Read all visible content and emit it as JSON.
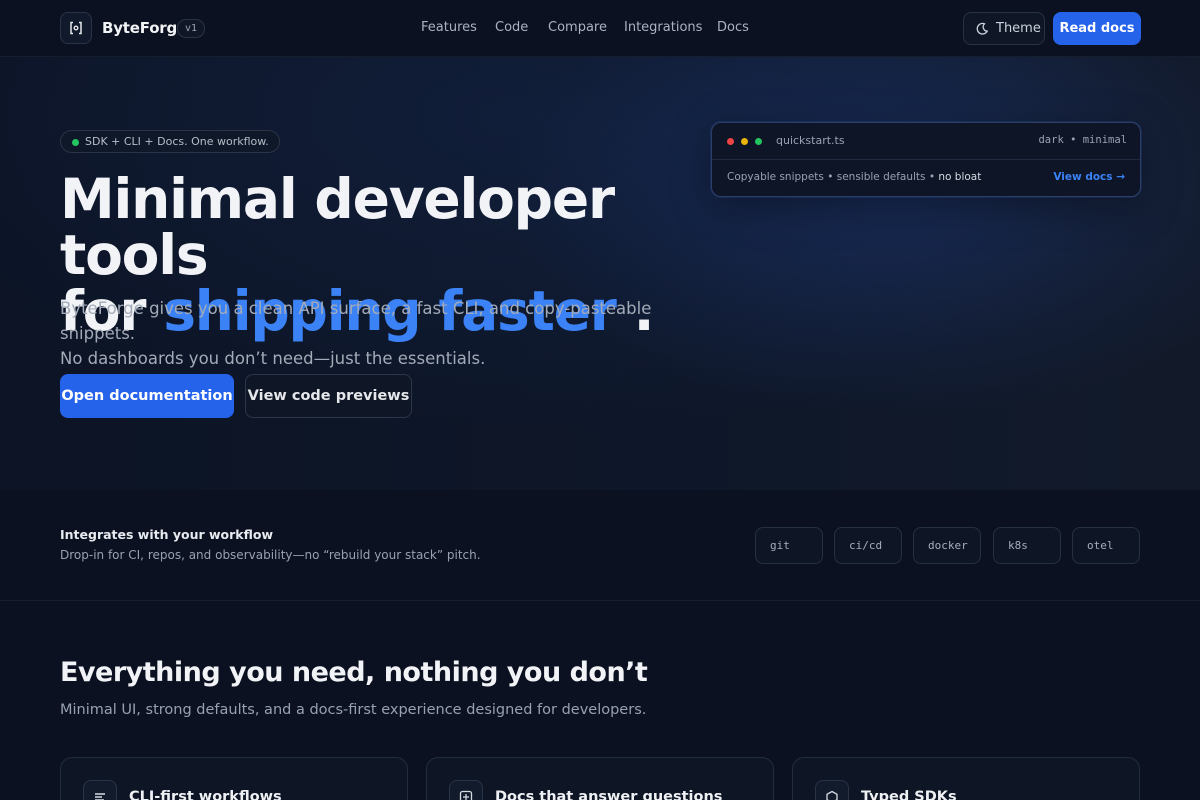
{
  "header": {
    "brand": "ByteForge",
    "version": "v1",
    "nav": [
      "Features",
      "Code",
      "Compare",
      "Integrations",
      "Docs"
    ],
    "theme_label": "Theme",
    "read_docs_label": "Read docs"
  },
  "hero": {
    "pill": "SDK + CLI + Docs. One workflow.",
    "title_line1": "Minimal developer tools",
    "title_for": "for",
    "title_accent": "shipping faster",
    "title_period": ".",
    "lede_line1": "ByteForge gives you a clean API surface, a fast CLI, and copy-pasteable snippets.",
    "lede_line2": "No dashboards you don’t need—just the essentials.",
    "primary_cta": "Open documentation",
    "secondary_cta": "View code previews"
  },
  "snippet_card": {
    "filename": "quickstart.ts",
    "mode": "dark • minimal",
    "desc_prefix": "Copyable snippets • sensible defaults • ",
    "desc_emph": "no bloat",
    "link": "View docs →",
    "traffic_colors": [
      "#ef4444",
      "#eab308",
      "#22c55e"
    ]
  },
  "integrations": {
    "title": "Integrates with your workflow",
    "subtitle": "Drop-in for CI, repos, and observability—no “rebuild your stack” pitch.",
    "chips": [
      "git",
      "ci/cd",
      "docker",
      "k8s",
      "otel"
    ]
  },
  "features": {
    "title": "Everything you need, nothing you don’t",
    "subtitle": "Minimal UI, strong defaults, and a docs-first experience designed for developers.",
    "cards": [
      {
        "title": "CLI-first workflows",
        "icon": "lines-icon"
      },
      {
        "title": "Docs that answer questions",
        "icon": "plus-square-icon"
      },
      {
        "title": "Typed SDKs",
        "icon": "hexagon-icon"
      }
    ]
  },
  "colors": {
    "accent": "#3b82f6",
    "primary_button": "#2563eb",
    "background": "#0b1120",
    "status_dot": "#22c55e"
  }
}
